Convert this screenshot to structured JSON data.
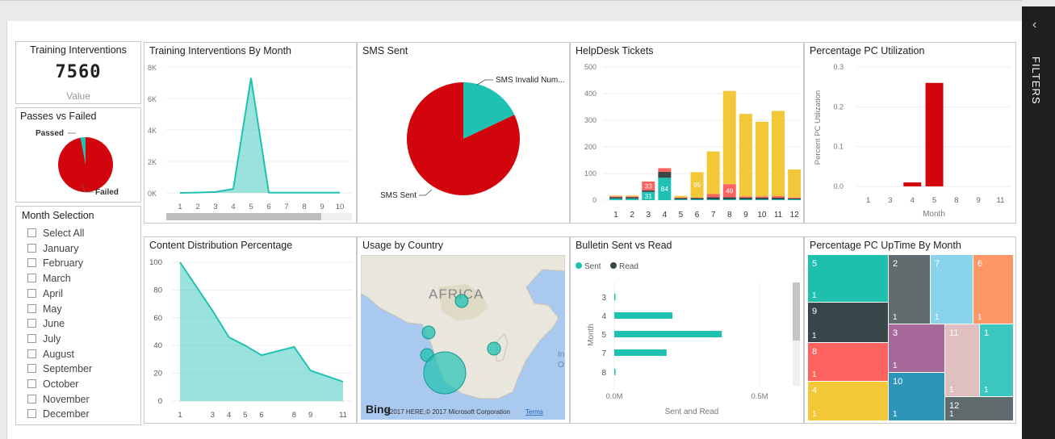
{
  "filters_pane": {
    "label": "FILTERS",
    "collapse_icon": "chevron-left-icon"
  },
  "card": {
    "title": "Training Interventions",
    "value": "7560",
    "subtitle": "Value"
  },
  "passes": {
    "title": "Passes vs Failed",
    "passed_label": "Passed",
    "failed_label": "Failed",
    "values": {
      "Passed": 3,
      "Failed": 97
    }
  },
  "slicer": {
    "title": "Month Selection",
    "items": [
      "Select All",
      "January",
      "February",
      "March",
      "April",
      "May",
      "June",
      "July",
      "August",
      "September",
      "October",
      "November",
      "December"
    ]
  },
  "training_month": {
    "title": "Training Interventions By Month"
  },
  "sms": {
    "title": "SMS Sent",
    "label_invalid": "SMS Invalid Num...",
    "label_sent": "SMS Sent"
  },
  "helpdesk": {
    "title": "HelpDesk Tickets"
  },
  "pc_util": {
    "title": "Percentage PC Utilization"
  },
  "content_dist": {
    "title": "Content Distribution Percentage"
  },
  "country": {
    "title": "Usage by Country",
    "region_label": "AFRICA",
    "logo": "Bing",
    "copyright": "©2017 HERE,© 2017 Microsoft Corporation",
    "terms": "Terms",
    "edge_text_1": "In",
    "edge_text_2": "O"
  },
  "bulletin": {
    "title": "Bulletin Sent vs Read"
  },
  "uptime": {
    "title": "Percentage PC UpTime By Month",
    "cells": [
      {
        "name": "5",
        "value": "1"
      },
      {
        "name": "2",
        "value": "1"
      },
      {
        "name": "7",
        "value": "1"
      },
      {
        "name": "6",
        "value": "1"
      },
      {
        "name": "9",
        "value": "1"
      },
      {
        "name": "3",
        "value": "1"
      },
      {
        "name": "11",
        "value": "1"
      },
      {
        "name": "1",
        "value": "1"
      },
      {
        "name": "8",
        "value": "1"
      },
      {
        "name": "10",
        "value": "1"
      },
      {
        "name": "4",
        "value": "1"
      },
      {
        "name": "12",
        "value": "1"
      }
    ]
  },
  "colors": {
    "teal": "#1fc2b2",
    "red": "#d2040c",
    "yellow": "#f2c838",
    "dark": "#374649",
    "salmon": "#fd625e"
  },
  "chart_data": [
    {
      "type": "area",
      "title": "Training Interventions By Month",
      "x": [
        1,
        2,
        3,
        4,
        5,
        6,
        7,
        8,
        9,
        10
      ],
      "values": [
        0,
        20,
        60,
        250,
        7300,
        10,
        10,
        10,
        10,
        10
      ],
      "y_ticks": [
        "0K",
        "2K",
        "4K",
        "6K",
        "8K"
      ],
      "ylim": [
        0,
        8000
      ]
    },
    {
      "type": "pie",
      "title": "SMS Sent",
      "categories": [
        "SMS Invalid Num...",
        "SMS Sent"
      ],
      "values": [
        18,
        82
      ]
    },
    {
      "type": "bar",
      "title": "HelpDesk Tickets",
      "categories": [
        "1",
        "2",
        "3",
        "4",
        "5",
        "6",
        "7",
        "8",
        "9",
        "10",
        "11",
        "12"
      ],
      "ylim": [
        0,
        500
      ],
      "y_ticks": [
        "0",
        "100",
        "200",
        "300",
        "400",
        "500"
      ],
      "series": [
        {
          "name": "teal",
          "values": [
            6,
            6,
            31,
            84,
            3,
            3,
            3,
            3,
            3,
            3,
            3,
            3
          ]
        },
        {
          "name": "dark",
          "values": [
            5,
            5,
            6,
            22,
            5,
            5,
            8,
            8,
            6,
            6,
            6,
            4
          ]
        },
        {
          "name": "salmon",
          "values": [
            3,
            3,
            33,
            14,
            2,
            2,
            12,
            49,
            5,
            5,
            6,
            3
          ]
        },
        {
          "name": "yellow",
          "values": [
            3,
            3,
            0,
            0,
            6,
            95,
            160,
            350,
            310,
            280,
            320,
            105
          ]
        }
      ],
      "data_labels": [
        {
          "category": "3",
          "series": "teal",
          "text": "31"
        },
        {
          "category": "3",
          "series": "salmon",
          "text": "33"
        },
        {
          "category": "4",
          "series": "teal",
          "text": "84"
        },
        {
          "category": "6",
          "series": "yellow",
          "text": "95"
        },
        {
          "category": "8",
          "series": "salmon",
          "text": "49"
        }
      ]
    },
    {
      "type": "bar",
      "title": "Percentage PC Utilization",
      "categories": [
        "1",
        "3",
        "4",
        "5",
        "8",
        "9",
        "11"
      ],
      "values": [
        0,
        0,
        0.01,
        0.26,
        0,
        0,
        0
      ],
      "ylabel": "Percent PC Utilization",
      "xlabel": "Month",
      "ylim": [
        0,
        0.3
      ],
      "y_ticks": [
        "0.0",
        "0.1",
        "0.2",
        "0.3"
      ]
    },
    {
      "type": "area",
      "title": "Content Distribution Percentage",
      "x": [
        1,
        3,
        4,
        5,
        6,
        8,
        9,
        11
      ],
      "values": [
        100,
        65,
        46,
        40,
        33,
        39,
        22,
        14
      ],
      "ylim": [
        0,
        100
      ],
      "y_ticks": [
        "0",
        "20",
        "40",
        "60",
        "80",
        "100"
      ]
    },
    {
      "type": "bar",
      "title": "Bulletin Sent vs Read",
      "legend": [
        "Sent",
        "Read"
      ],
      "categories": [
        "3",
        "4",
        "5",
        "7",
        "8"
      ],
      "values": [
        0.003,
        0.2,
        0.37,
        0.18,
        0.003
      ],
      "ylabel": "Month",
      "xlabel": "Sent and Read",
      "x_ticks": [
        "0.0M",
        "0.5M"
      ],
      "xlim": [
        0,
        0.5
      ]
    }
  ]
}
